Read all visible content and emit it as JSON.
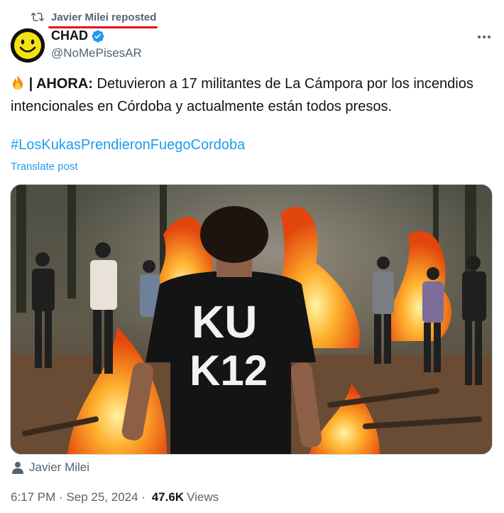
{
  "repost": {
    "name": "Javier Milei",
    "suffix": "reposted"
  },
  "author": {
    "display_name": "CHAD",
    "handle": "@NoMePisesAR"
  },
  "tweet": {
    "lead": "| AHORA:",
    "text": "Detuvieron a 17 militantes de La Cámpora por los incendios intencionales en Córdoba y actualmente están todos presos.",
    "hashtag": "#LosKukasPrendieronFuegoCordoba",
    "translate_label": "Translate post"
  },
  "media": {
    "shirt_text_line1": "KU",
    "shirt_text_line2": "K12"
  },
  "tagged_user": "Javier Milei",
  "meta": {
    "time": "6:17 PM",
    "date": "Sep 25, 2024",
    "views_count": "47.6K",
    "views_label": "Views"
  },
  "colors": {
    "link": "#1d9bf0",
    "secondary": "#536471",
    "verified": "#1d9bf0",
    "repost_underline": "#e0141e"
  }
}
